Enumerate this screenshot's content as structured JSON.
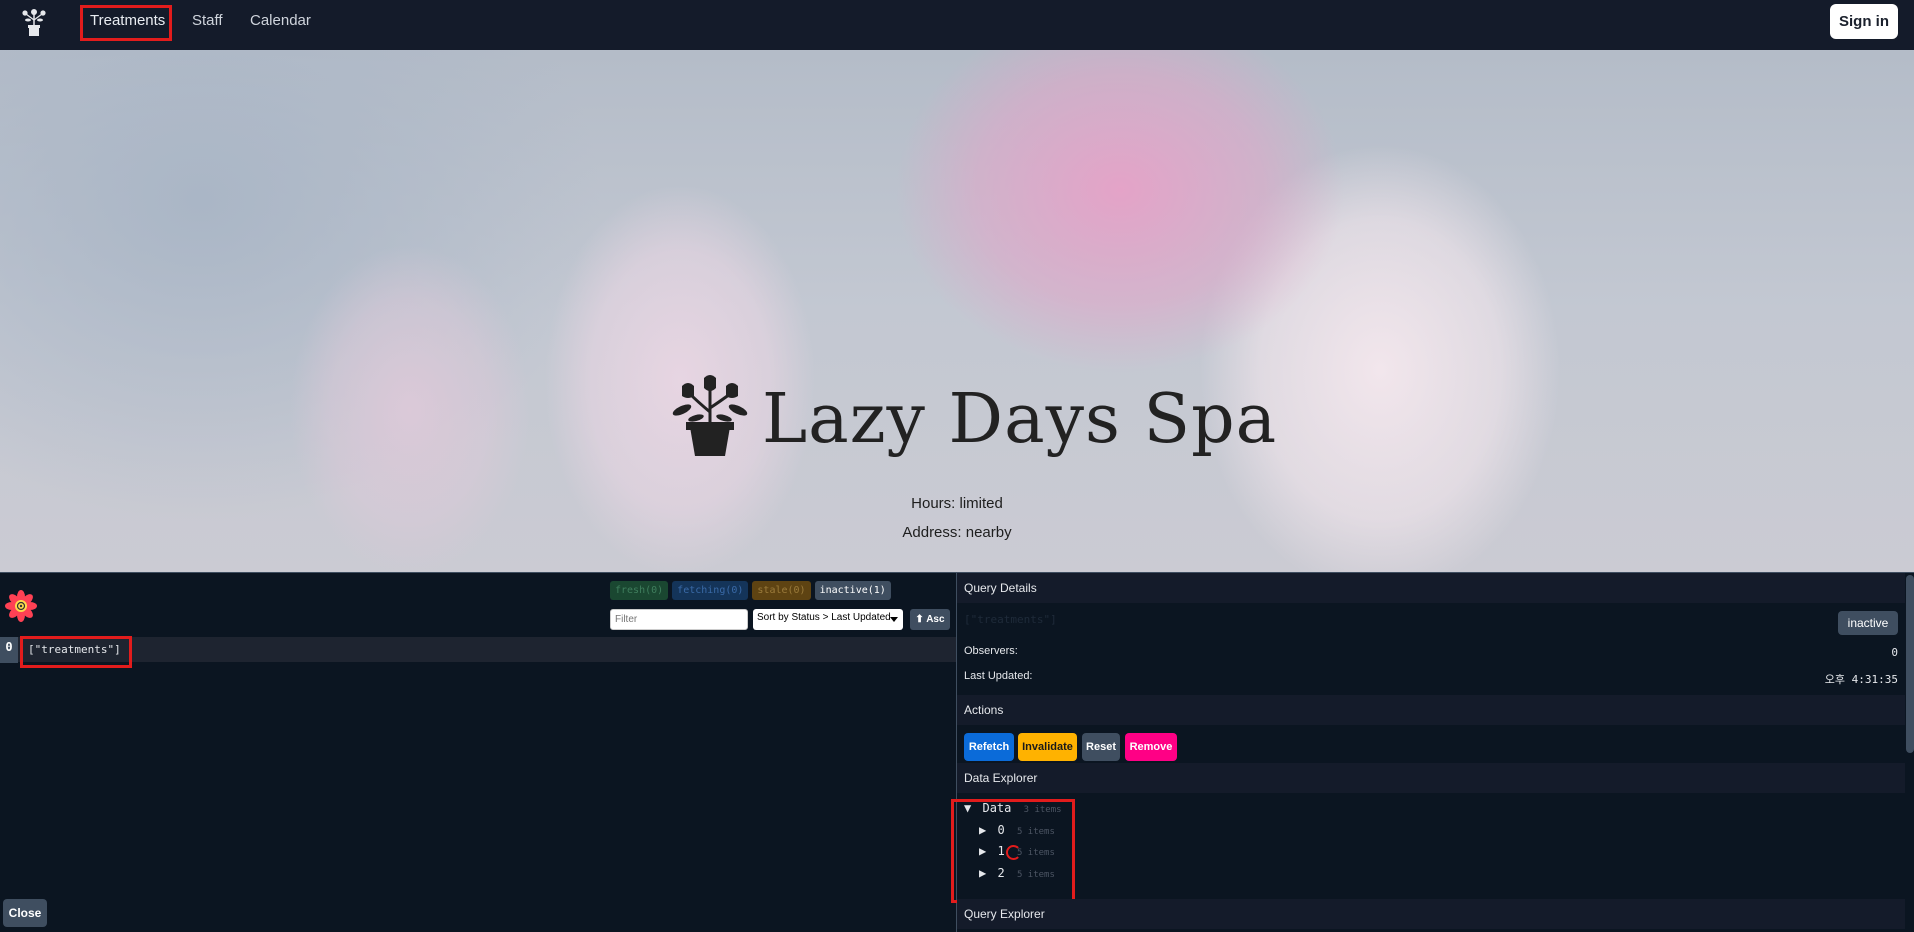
{
  "navbar": {
    "links": [
      {
        "label": "Treatments"
      },
      {
        "label": "Staff"
      },
      {
        "label": "Calendar"
      }
    ],
    "sign_in": "Sign in"
  },
  "hero": {
    "title": "Lazy Days Spa",
    "hours": "Hours: limited",
    "address": "Address: nearby"
  },
  "devtools": {
    "badges": {
      "fresh": "fresh(0)",
      "fetching": "fetching(0)",
      "stale": "stale(0)",
      "inactive": "inactive(1)"
    },
    "filter_placeholder": "Filter",
    "sort_label": "Sort by Status > Last Updated",
    "asc_label": "⬆ Asc",
    "queries": [
      {
        "observers": "0",
        "key": "[\"treatments\"]"
      }
    ],
    "close_label": "Close",
    "details": {
      "header": "Query Details",
      "query_hash": "[\"treatments\"]",
      "status": "inactive",
      "observers_label": "Observers:",
      "observers_value": "0",
      "last_updated_label": "Last Updated:",
      "last_updated_value": "오후 4:31:35"
    },
    "actions": {
      "header": "Actions",
      "refetch": "Refetch",
      "invalidate": "Invalidate",
      "reset": "Reset",
      "remove": "Remove"
    },
    "data_explorer": {
      "header": "Data Explorer",
      "root_label": "Data",
      "root_count": "3 items",
      "items": [
        {
          "index": "0",
          "count": "5 items"
        },
        {
          "index": "1",
          "count": "5 items"
        },
        {
          "index": "2",
          "count": "5 items"
        }
      ]
    },
    "query_explorer_header": "Query Explorer"
  }
}
